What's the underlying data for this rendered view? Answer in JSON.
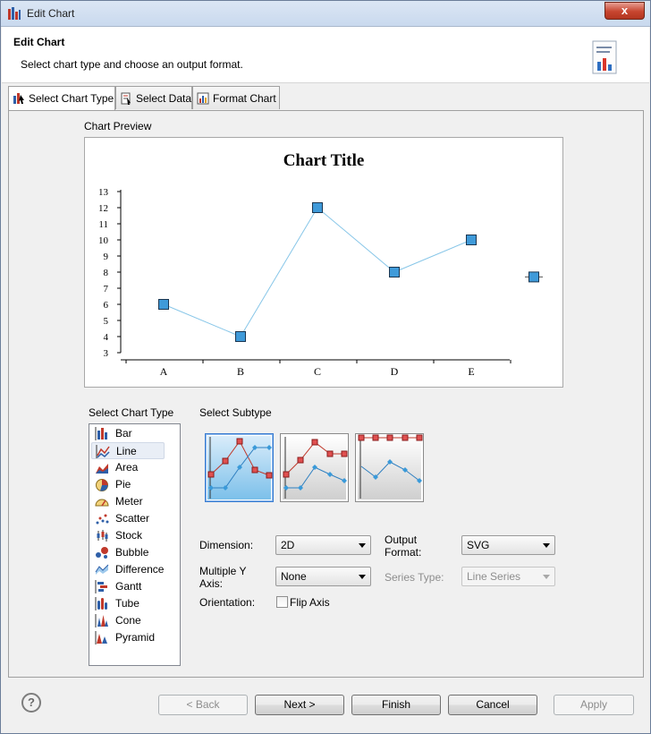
{
  "window": {
    "title": "Edit Chart",
    "close_glyph": "x"
  },
  "header": {
    "title": "Edit Chart",
    "subtitle": "Select chart type and choose an output format.",
    "icon": "chart-wizard-icon"
  },
  "tabs": [
    {
      "label": "Select Chart Type",
      "icon": "chart-type-icon",
      "active": true
    },
    {
      "label": "Select Data",
      "icon": "data-icon",
      "active": false
    },
    {
      "label": "Format Chart",
      "icon": "format-chart-icon",
      "active": false
    }
  ],
  "preview": {
    "label": "Chart Preview",
    "chart_data": {
      "type": "line",
      "title": "Chart Title",
      "categories": [
        "A",
        "B",
        "C",
        "D",
        "E"
      ],
      "values": [
        6,
        4,
        12,
        8,
        10
      ],
      "extra_point": 7.7,
      "y_ticks": [
        "3",
        "4",
        "5",
        "6",
        "7",
        "8",
        "9",
        "10",
        "11",
        "12",
        "13"
      ],
      "ylim": [
        3,
        13
      ],
      "line_color": "#87c6e8",
      "marker_color": "#3f9ad9"
    }
  },
  "chart_types": {
    "label": "Select Chart Type",
    "selected": "Line",
    "items": [
      {
        "label": "Bar",
        "icon": "bar-chart-icon"
      },
      {
        "label": "Line",
        "icon": "line-chart-icon"
      },
      {
        "label": "Area",
        "icon": "area-chart-icon"
      },
      {
        "label": "Pie",
        "icon": "pie-chart-icon"
      },
      {
        "label": "Meter",
        "icon": "meter-chart-icon"
      },
      {
        "label": "Scatter",
        "icon": "scatter-chart-icon"
      },
      {
        "label": "Stock",
        "icon": "stock-chart-icon"
      },
      {
        "label": "Bubble",
        "icon": "bubble-chart-icon"
      },
      {
        "label": "Difference",
        "icon": "difference-chart-icon"
      },
      {
        "label": "Gantt",
        "icon": "gantt-chart-icon"
      },
      {
        "label": "Tube",
        "icon": "tube-chart-icon"
      },
      {
        "label": "Cone",
        "icon": "cone-chart-icon"
      },
      {
        "label": "Pyramid",
        "icon": "pyramid-chart-icon"
      }
    ]
  },
  "subtype": {
    "label": "Select Subtype",
    "selected_index": 0
  },
  "options": {
    "dimension_label": "Dimension:",
    "dimension_value": "2D",
    "output_format_label": "Output Format:",
    "output_format_value": "SVG",
    "multiple_y_label": "Multiple Y Axis:",
    "multiple_y_value": "None",
    "series_type_label": "Series Type:",
    "series_type_value": "Line Series",
    "orientation_label": "Orientation:",
    "flip_axis_label": "Flip Axis",
    "flip_axis_checked": false
  },
  "buttons": {
    "help": "?",
    "back": "< Back",
    "next": "Next >",
    "finish": "Finish",
    "cancel": "Cancel",
    "apply": "Apply"
  }
}
